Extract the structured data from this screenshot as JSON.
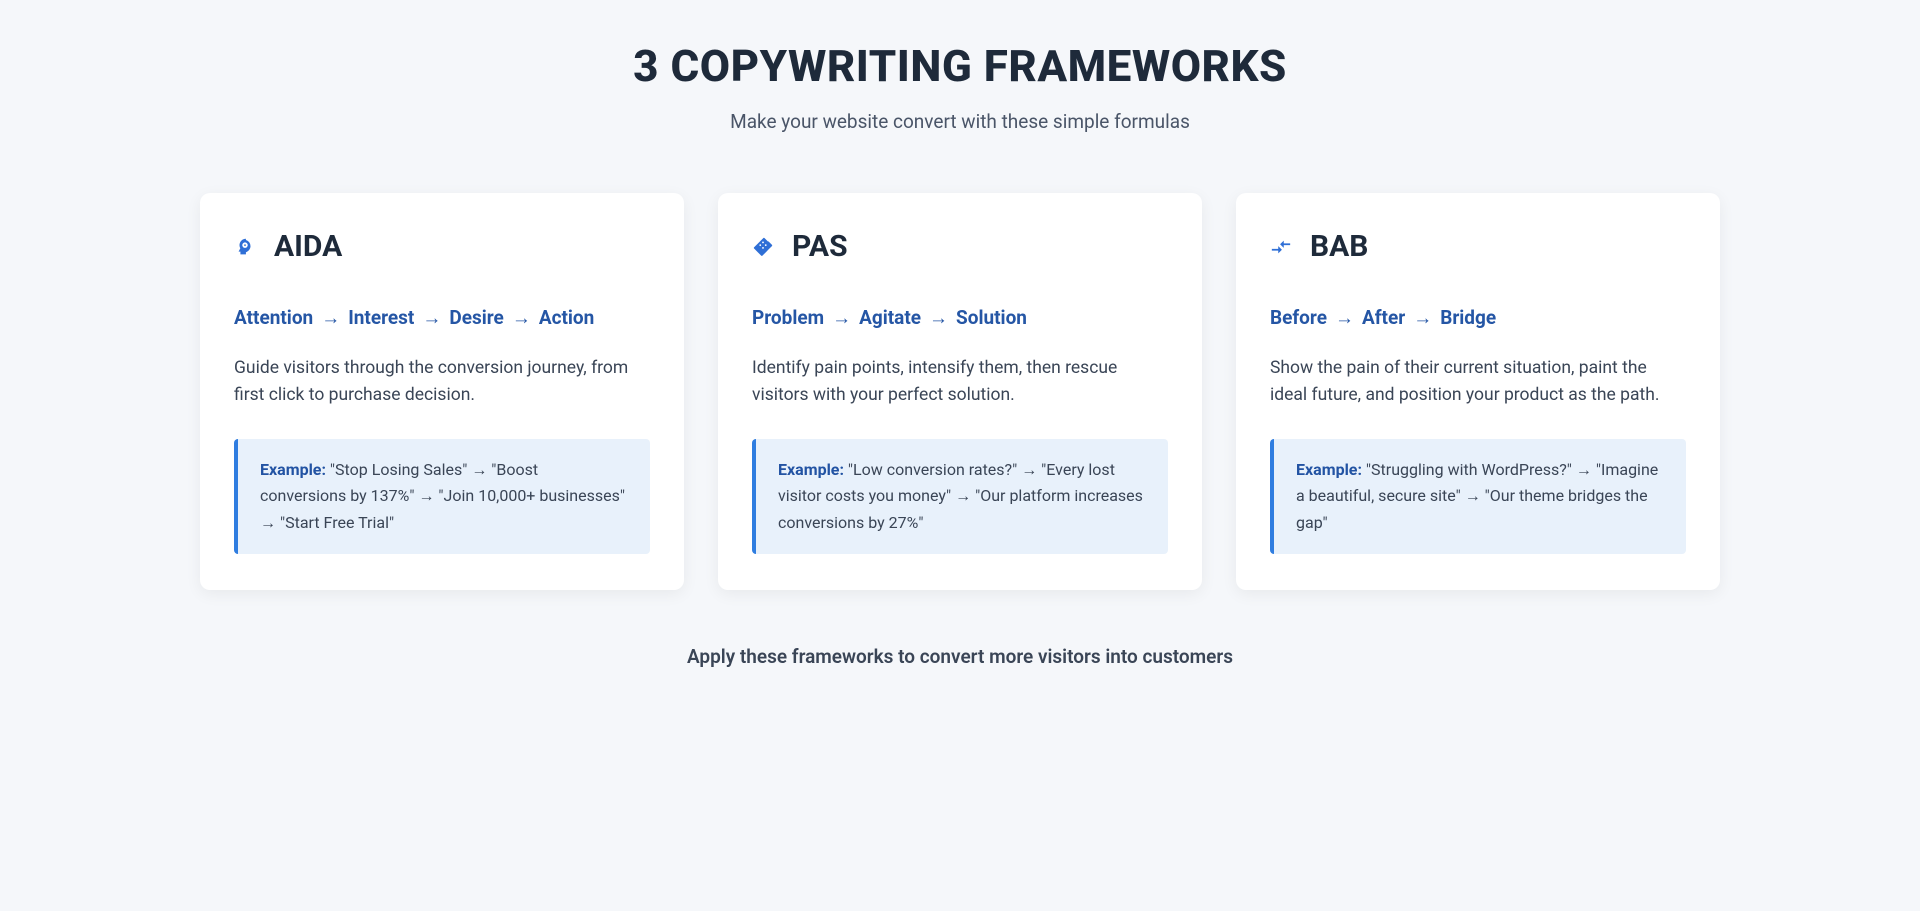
{
  "title": "3 COPYWRITING FRAMEWORKS",
  "subtitle": "Make your website convert with these simple formulas",
  "footer": "Apply these frameworks to convert more visitors into customers",
  "example_label": "Example:",
  "cards": [
    {
      "name": "AIDA",
      "steps": [
        "Attention",
        "Interest",
        "Desire",
        "Action"
      ],
      "description": "Guide visitors through the conversion journey, from first click to purchase decision.",
      "example": " \"Stop Losing Sales\" → \"Boost conversions by 137%\" → \"Join 10,000+ businesses\" → \"Start Free Trial\""
    },
    {
      "name": "PAS",
      "steps": [
        "Problem",
        "Agitate",
        "Solution"
      ],
      "description": "Identify pain points, intensify them, then rescue visitors with your perfect solution.",
      "example": " \"Low conversion rates?\" → \"Every lost visitor costs you money\" → \"Our platform increases conversions by 27%\""
    },
    {
      "name": "BAB",
      "steps": [
        "Before",
        "After",
        "Bridge"
      ],
      "description": "Show the pain of their current situation, paint the ideal future, and position your product as the path.",
      "example": " \"Struggling with WordPress?\" → \"Imagine a beautiful, secure site\" → \"Our theme bridges the gap\""
    }
  ]
}
